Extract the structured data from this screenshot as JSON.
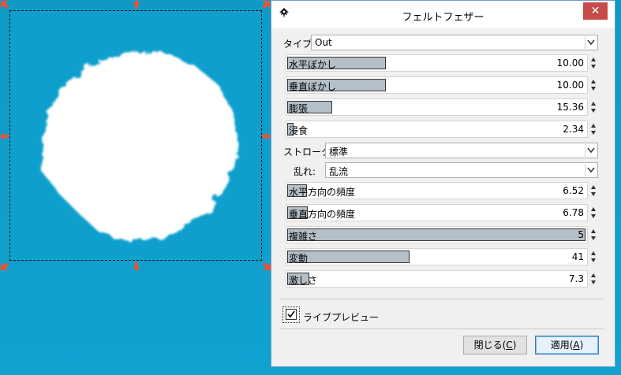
{
  "dialog": {
    "title": "フェルトフェザー",
    "close_glyph": "✕",
    "type_label": "タイプ:",
    "type_value": "Out",
    "blur_h_label": "水平ぼかし",
    "blur_h_value": "10.00",
    "blur_h_fraction": 0.33,
    "blur_v_label": "垂直ぼかし",
    "blur_v_value": "10.00",
    "blur_v_fraction": 0.33,
    "dilate_label": "膨張",
    "dilate_value": "15.36",
    "dilate_fraction": 0.15,
    "erode_label": "浸食",
    "erode_value": "2.34",
    "erode_fraction": 0.02,
    "stroke_label": "ストローク:",
    "stroke_value": "標準",
    "turbulence_label": "乱れ:",
    "turbulence_value": "乱流",
    "freq_h_label": "水平方向の頻度",
    "freq_h_value": "6.52",
    "freq_h_fraction": 0.065,
    "freq_v_label": "垂直方向の頻度",
    "freq_v_value": "6.78",
    "freq_v_fraction": 0.068,
    "complexity_label": "複雑さ",
    "complexity_value": "5",
    "complexity_fraction": 1.0,
    "variation_label": "変動",
    "variation_value": "41",
    "variation_fraction": 0.41,
    "intensity_label": "激しさ",
    "intensity_value": "7.3",
    "intensity_fraction": 0.073,
    "live_preview_label": "ライブプレビュー",
    "live_preview_checked": true,
    "close_button": {
      "text": "閉じる(",
      "key": "C",
      "end": ")"
    },
    "apply_button": {
      "text": "適用(",
      "key": "A",
      "end": ")"
    }
  },
  "colors": {
    "canvas_blue": "#0e9fcd",
    "handle_red": "#e8543a",
    "slider_fill": "#b4bfc8"
  }
}
